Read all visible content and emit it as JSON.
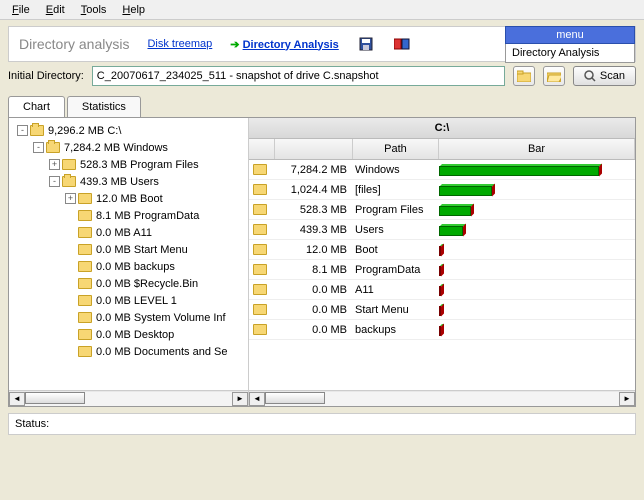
{
  "menubar": {
    "file": "File",
    "edit": "Edit",
    "tools": "Tools",
    "help": "Help"
  },
  "toolbar": {
    "title": "Directory analysis",
    "link_treemap": "Disk treemap",
    "link_analysis": "Directory Analysis",
    "side_menu_header": "menu",
    "side_menu_option": "Directory Analysis"
  },
  "dir": {
    "label": "Initial Directory:",
    "value": "C_20070617_234025_511 - snapshot of drive C.snapshot",
    "scan": "Scan"
  },
  "tabs": {
    "chart": "Chart",
    "stats": "Statistics"
  },
  "tree": [
    {
      "depth": 0,
      "exp": "-",
      "open": true,
      "text": "9,296.2 MB C:\\"
    },
    {
      "depth": 1,
      "exp": "-",
      "open": true,
      "text": "7,284.2 MB Windows"
    },
    {
      "depth": 2,
      "exp": "+",
      "open": false,
      "text": "528.3 MB Program Files"
    },
    {
      "depth": 2,
      "exp": "-",
      "open": true,
      "text": "439.3 MB Users"
    },
    {
      "depth": 3,
      "exp": "+",
      "open": false,
      "text": "12.0 MB Boot"
    },
    {
      "depth": 3,
      "exp": "",
      "open": false,
      "text": "8.1 MB ProgramData"
    },
    {
      "depth": 3,
      "exp": "",
      "open": false,
      "text": "0.0 MB A11"
    },
    {
      "depth": 3,
      "exp": "",
      "open": false,
      "text": "0.0 MB Start Menu"
    },
    {
      "depth": 3,
      "exp": "",
      "open": false,
      "text": "0.0 MB backups"
    },
    {
      "depth": 3,
      "exp": "",
      "open": false,
      "text": "0.0 MB $Recycle.Bin"
    },
    {
      "depth": 3,
      "exp": "",
      "open": false,
      "text": "0.0 MB LEVEL 1"
    },
    {
      "depth": 3,
      "exp": "",
      "open": false,
      "text": "0.0 MB System Volume Inf"
    },
    {
      "depth": 3,
      "exp": "",
      "open": false,
      "text": "0.0 MB Desktop"
    },
    {
      "depth": 3,
      "exp": "",
      "open": false,
      "text": "0.0 MB Documents and Se"
    }
  ],
  "right": {
    "path": "C:\\",
    "head_path": "Path",
    "head_bar": "Bar",
    "rows": [
      {
        "size": "7,284.2 MB",
        "name": "Windows",
        "pct": 100,
        "small": false
      },
      {
        "size": "1,024.4 MB",
        "name": "[files]",
        "pct": 33,
        "small": false
      },
      {
        "size": "528.3 MB",
        "name": "Program Files",
        "pct": 20,
        "small": false
      },
      {
        "size": "439.3 MB",
        "name": "Users",
        "pct": 15,
        "small": false
      },
      {
        "size": "12.0 MB",
        "name": "Boot",
        "pct": 1,
        "small": true
      },
      {
        "size": "8.1 MB",
        "name": "ProgramData",
        "pct": 1,
        "small": true
      },
      {
        "size": "0.0 MB",
        "name": "A11",
        "pct": 1,
        "small": true
      },
      {
        "size": "0.0 MB",
        "name": "Start Menu",
        "pct": 1,
        "small": true
      },
      {
        "size": "0.0 MB",
        "name": "backups",
        "pct": 1,
        "small": true
      }
    ]
  },
  "status": {
    "label": "Status:"
  },
  "chart_data": {
    "type": "bar",
    "title": "C:\\",
    "categories": [
      "Windows",
      "[files]",
      "Program Files",
      "Users",
      "Boot",
      "ProgramData",
      "A11",
      "Start Menu",
      "backups"
    ],
    "values": [
      7284.2,
      1024.4,
      528.3,
      439.3,
      12.0,
      8.1,
      0.0,
      0.0,
      0.0
    ],
    "xlabel": "Path",
    "ylabel": "MB",
    "ylim": [
      0,
      7300
    ]
  }
}
